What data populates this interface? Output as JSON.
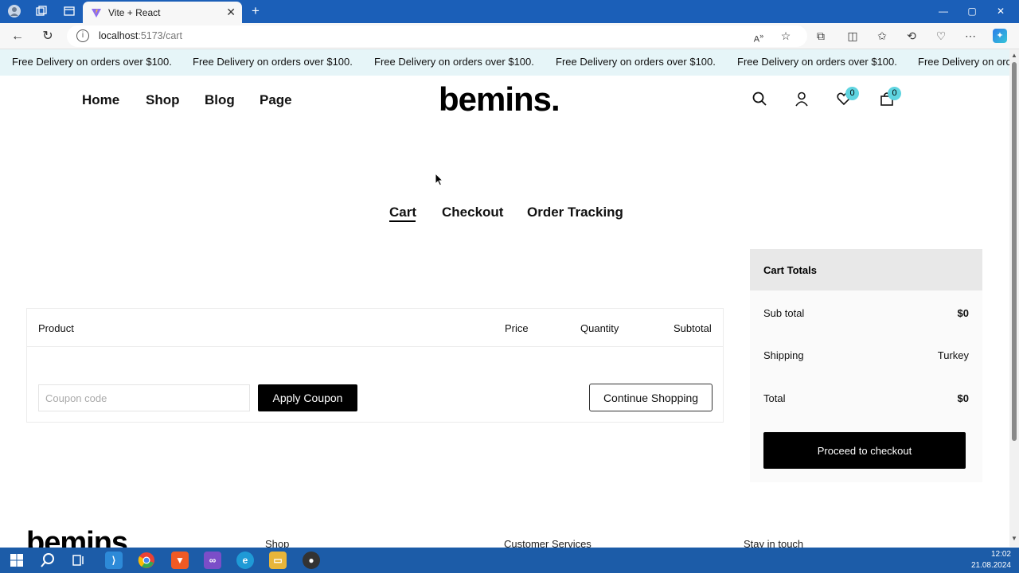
{
  "browser": {
    "tab_title": "Vite + React",
    "url_host": "localhost",
    "url_path": ":5173/cart"
  },
  "announcement": {
    "text": "Free Delivery on orders over $100.",
    "text_truncated": "Free Delivery on orc"
  },
  "header": {
    "menu": [
      "Home",
      "Shop",
      "Blog",
      "Page"
    ],
    "logo": "bemins.",
    "wishlist_count": "0",
    "cart_count": "0"
  },
  "page_tabs": [
    "Cart",
    "Checkout",
    "Order Tracking"
  ],
  "cart_table": {
    "columns": [
      "Product",
      "Price",
      "Quantity",
      "Subtotal"
    ],
    "coupon_placeholder": "Coupon code",
    "apply_label": "Apply Coupon",
    "continue_label": "Continue Shopping"
  },
  "totals": {
    "title": "Cart Totals",
    "subtotal_label": "Sub total",
    "subtotal_value": "$0",
    "shipping_label": "Shipping",
    "shipping_value": "Turkey",
    "total_label": "Total",
    "total_value": "$0",
    "checkout_label": "Proceed to checkout"
  },
  "footer": {
    "logo": "bemins.",
    "col1": "Shop",
    "col2": "Customer Services",
    "col3": "Stay in touch"
  },
  "taskbar": {
    "time": "12:02",
    "date": "21.08.2024"
  },
  "colors": {
    "titlebar": "#1b5fb8",
    "announcement_bg": "#e6f5f8",
    "badge": "#5fd4e0",
    "taskbar": "#1c5ca8"
  }
}
